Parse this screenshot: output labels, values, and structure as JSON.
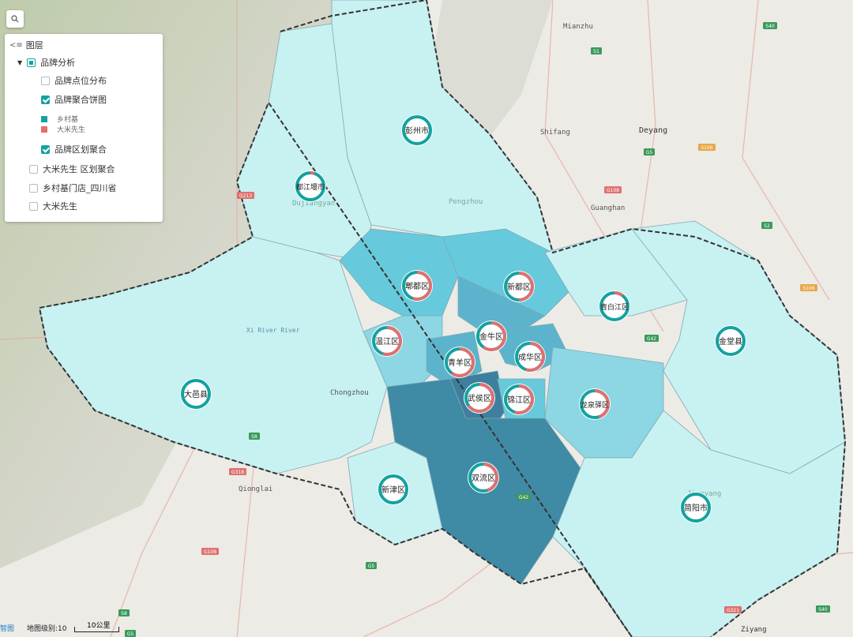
{
  "layer_panel": {
    "title": "图层",
    "items": [
      {
        "label": "品牌分析",
        "state": "half"
      },
      {
        "label": "品牌点位分布",
        "state": "off"
      },
      {
        "label": "品牌聚合饼图",
        "state": "on"
      },
      {
        "label": "品牌区划聚合",
        "state": "on"
      },
      {
        "label": "大米先生 区划聚合",
        "state": "off"
      },
      {
        "label": "乡村基门店_四川省",
        "state": "off"
      },
      {
        "label": "大米先生",
        "state": "off"
      }
    ],
    "legend": [
      {
        "label": "乡村基",
        "color": "#13a2a0"
      },
      {
        "label": "大米先生",
        "color": "#e07070"
      }
    ]
  },
  "footer": {
    "logo_text": "智图",
    "zoom_label": "地图级别:10",
    "scale_label": "10公里"
  },
  "districts": [
    {
      "name": "彭州市",
      "share": 0.0
    },
    {
      "name": "都江堰市",
      "share": 0.05
    },
    {
      "name": "郫都区",
      "share": 0.55
    },
    {
      "name": "新都区",
      "share": 0.5
    },
    {
      "name": "青白江区",
      "share": 0.1
    },
    {
      "name": "温江区",
      "share": 0.55
    },
    {
      "name": "金牛区",
      "share": 0.6
    },
    {
      "name": "青羊区",
      "share": 0.6
    },
    {
      "name": "成华区",
      "share": 0.55
    },
    {
      "name": "武侯区",
      "share": 0.65
    },
    {
      "name": "锦江区",
      "share": 0.55
    },
    {
      "name": "龙泉驿区",
      "share": 0.45
    },
    {
      "name": "金堂县",
      "share": 0.0
    },
    {
      "name": "大邑县",
      "share": 0.0
    },
    {
      "name": "新津区",
      "share": 0.0
    },
    {
      "name": "双流区",
      "share": 0.45
    },
    {
      "name": "简阳市",
      "share": 0.0
    }
  ],
  "place_labels": [
    {
      "text": "Mianzhu"
    },
    {
      "text": "Shifang"
    },
    {
      "text": "Deyang"
    },
    {
      "text": "Guanghan"
    },
    {
      "text": "Pengzhou"
    },
    {
      "text": "Dujiangyan"
    },
    {
      "text": "Xi River River"
    },
    {
      "text": "Chongzhou"
    },
    {
      "text": "Qionglai"
    },
    {
      "text": "Jianyang"
    },
    {
      "text": "Ziyang"
    }
  ],
  "road_shields": [
    {
      "text": "S1"
    },
    {
      "text": "S40"
    },
    {
      "text": "G5"
    },
    {
      "text": "S106"
    },
    {
      "text": "G108"
    },
    {
      "text": "S2"
    },
    {
      "text": "G213"
    },
    {
      "text": "S106"
    },
    {
      "text": "G42"
    },
    {
      "text": "S8"
    },
    {
      "text": "G318"
    },
    {
      "text": "G108"
    },
    {
      "text": "G5"
    },
    {
      "text": "S8"
    },
    {
      "text": "G5"
    },
    {
      "text": "G42"
    },
    {
      "text": "G321"
    },
    {
      "text": "S40"
    }
  ]
}
